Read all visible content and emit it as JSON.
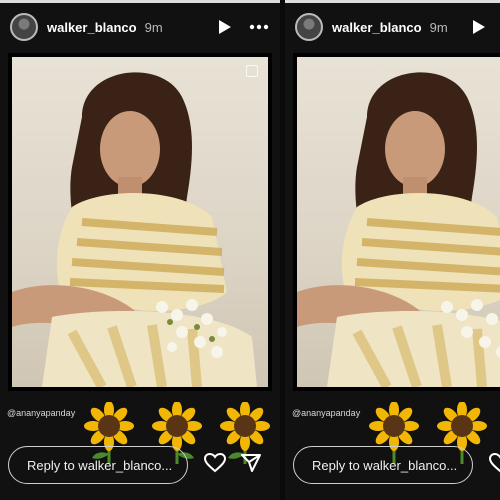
{
  "story": {
    "username": "walker_blanco",
    "time": "9m",
    "mention": "@ananyapanday",
    "reply_placeholder": "Reply to walker_blanco..."
  },
  "icons": {
    "play": "play-icon",
    "more": "more-options-icon",
    "heart": "heart-icon",
    "send": "send-icon",
    "sticker": "sunflower-sticker",
    "multi": "square-outline-icon"
  },
  "colors": {
    "background": "#111111",
    "text": "#ffffff",
    "muted": "#b8b8b8",
    "sunflower_petal": "#f2b705",
    "sunflower_center": "#5a3515"
  }
}
